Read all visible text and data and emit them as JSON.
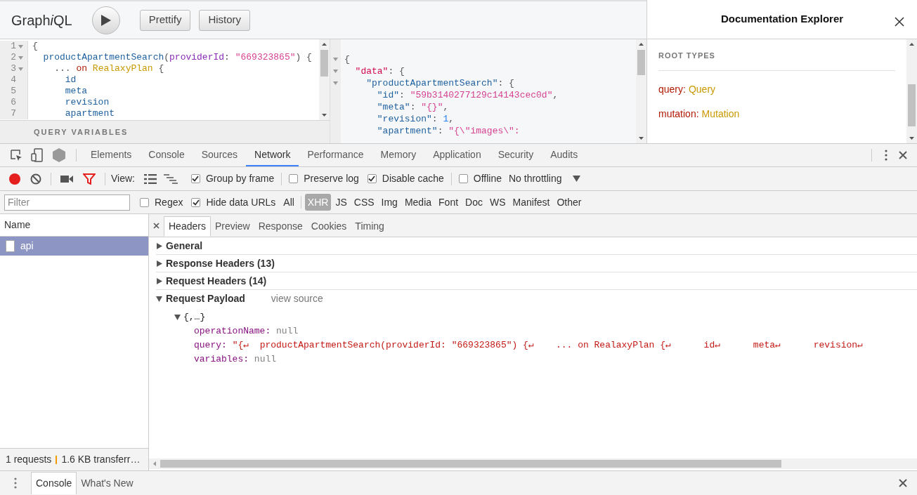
{
  "graphiql": {
    "logo": [
      {
        "text": "Graph",
        "italic": false
      },
      {
        "text": "i",
        "italic": true
      },
      {
        "text": "QL",
        "italic": false
      }
    ],
    "buttons": [
      "Prettify",
      "History"
    ],
    "query_lines": [
      {
        "number": "1",
        "foldable": true,
        "segments": [
          {
            "kind": "punct",
            "text": "{"
          }
        ]
      },
      {
        "number": "2",
        "foldable": true,
        "segments": [
          {
            "kind": "field",
            "text": "  productApartmentSearch"
          },
          {
            "kind": "punct",
            "text": "("
          },
          {
            "kind": "attribute",
            "text": "providerId"
          },
          {
            "kind": "punct",
            "text": ": "
          },
          {
            "kind": "string",
            "text": "\"669323865\""
          },
          {
            "kind": "punct",
            "text": ") {"
          }
        ]
      },
      {
        "number": "3",
        "foldable": true,
        "segments": [
          {
            "kind": "punct",
            "text": "    ... "
          },
          {
            "kind": "keyword",
            "text": "on"
          },
          {
            "kind": "type",
            "text": " RealaxyPlan"
          },
          {
            "kind": "punct",
            "text": " {"
          }
        ]
      },
      {
        "number": "4",
        "foldable": false,
        "segments": [
          {
            "kind": "field",
            "text": "      id"
          }
        ]
      },
      {
        "number": "5",
        "foldable": false,
        "segments": [
          {
            "kind": "field",
            "text": "      meta"
          }
        ]
      },
      {
        "number": "6",
        "foldable": false,
        "segments": [
          {
            "kind": "field",
            "text": "      revision"
          }
        ]
      },
      {
        "number": "7",
        "foldable": false,
        "segments": [
          {
            "kind": "field",
            "text": "      apartment"
          }
        ]
      }
    ],
    "variables_label": "QUERY VARIABLES",
    "result_lines": [
      {
        "foldable": true,
        "segments": [
          {
            "kind": "punct",
            "text": "{"
          }
        ]
      },
      {
        "foldable": true,
        "segments": [
          {
            "kind": "def",
            "text": "  \"data\""
          },
          {
            "kind": "punct",
            "text": ": {"
          }
        ]
      },
      {
        "foldable": true,
        "segments": [
          {
            "kind": "field",
            "text": "    \"productApartmentSearch\""
          },
          {
            "kind": "punct",
            "text": ": {"
          }
        ]
      },
      {
        "foldable": false,
        "segments": [
          {
            "kind": "field",
            "text": "      \"id\""
          },
          {
            "kind": "punct",
            "text": ": "
          },
          {
            "kind": "string",
            "text": "\"59b3140277129c14143cec0d\""
          },
          {
            "kind": "punct",
            "text": ","
          }
        ]
      },
      {
        "foldable": false,
        "segments": [
          {
            "kind": "field",
            "text": "      \"meta\""
          },
          {
            "kind": "punct",
            "text": ": "
          },
          {
            "kind": "string",
            "text": "\"{}\""
          },
          {
            "kind": "punct",
            "text": ","
          }
        ]
      },
      {
        "foldable": false,
        "segments": [
          {
            "kind": "field",
            "text": "      \"revision\""
          },
          {
            "kind": "punct",
            "text": ": "
          },
          {
            "kind": "number",
            "text": "1"
          },
          {
            "kind": "punct",
            "text": ","
          }
        ]
      },
      {
        "foldable": false,
        "segments": [
          {
            "kind": "field",
            "text": "      \"apartment\""
          },
          {
            "kind": "punct",
            "text": ": "
          },
          {
            "kind": "string",
            "text": "\"{\\\"images\\\":"
          }
        ]
      }
    ],
    "docs": {
      "title": "Documentation Explorer",
      "section": "ROOT TYPES",
      "types": [
        {
          "field": "query:",
          "type": "Query"
        },
        {
          "field": "mutation:",
          "type": "Mutation"
        }
      ]
    }
  },
  "devtools": {
    "tabs": [
      {
        "label": "Elements",
        "selected": false
      },
      {
        "label": "Console",
        "selected": false
      },
      {
        "label": "Sources",
        "selected": false
      },
      {
        "label": "Network",
        "selected": true
      },
      {
        "label": "Performance",
        "selected": false
      },
      {
        "label": "Memory",
        "selected": false
      },
      {
        "label": "Application",
        "selected": false
      },
      {
        "label": "Security",
        "selected": false
      },
      {
        "label": "Audits",
        "selected": false
      }
    ],
    "toolbar": {
      "view_label": "View:",
      "options": [
        {
          "label": "Group by frame",
          "checked": true
        },
        {
          "label": "Preserve log",
          "checked": false
        },
        {
          "label": "Disable cache",
          "checked": true
        },
        {
          "label": "Offline",
          "checked": false
        }
      ],
      "throttling": "No throttling"
    },
    "filter": {
      "placeholder": "Filter",
      "options": [
        {
          "label": "Regex",
          "checked": false
        },
        {
          "label": "Hide data URLs",
          "checked": true
        }
      ],
      "types": [
        {
          "label": "All",
          "selected": false
        },
        {
          "label": "XHR",
          "selected": true
        },
        {
          "label": "JS",
          "selected": false
        },
        {
          "label": "CSS",
          "selected": false
        },
        {
          "label": "Img",
          "selected": false
        },
        {
          "label": "Media",
          "selected": false
        },
        {
          "label": "Font",
          "selected": false
        },
        {
          "label": "Doc",
          "selected": false
        },
        {
          "label": "WS",
          "selected": false
        },
        {
          "label": "Manifest",
          "selected": false
        },
        {
          "label": "Other",
          "selected": false
        }
      ]
    },
    "requests": {
      "header": "Name",
      "rows": [
        {
          "name": "api",
          "selected": true
        }
      ]
    },
    "detail_tabs": [
      {
        "label": "Headers",
        "selected": true
      },
      {
        "label": "Preview",
        "selected": false
      },
      {
        "label": "Response",
        "selected": false
      },
      {
        "label": "Cookies",
        "selected": false
      },
      {
        "label": "Timing",
        "selected": false
      }
    ],
    "sections": [
      {
        "label": "General",
        "expanded": false
      },
      {
        "label": "Response Headers (13)",
        "expanded": false
      },
      {
        "label": "Request Headers (14)",
        "expanded": false
      },
      {
        "label": "Request Payload",
        "expanded": true,
        "link": "view source"
      }
    ],
    "payload": {
      "summary": "{,…}",
      "entries": [
        {
          "key": "operationName:",
          "kind": "null",
          "value": "null"
        },
        {
          "key": "query:",
          "kind": "string",
          "value": "\"{↵  productApartmentSearch(providerId: \"669323865\") {↵    ... on RealaxyPlan {↵      id↵      meta↵      revision↵"
        },
        {
          "key": "variables:",
          "kind": "null",
          "value": "null"
        }
      ]
    },
    "status": {
      "requests": "1 requests",
      "transferred": "1.6 KB transferr…"
    },
    "drawer_tabs": [
      {
        "label": "Console",
        "selected": true
      },
      {
        "label": "What's New",
        "selected": false
      }
    ]
  }
}
